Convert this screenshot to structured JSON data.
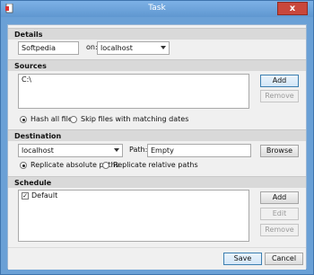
{
  "window": {
    "title": "Task",
    "close_glyph": "x"
  },
  "details": {
    "header": "Details",
    "name_value": "Softpedia",
    "on_label": "on:",
    "host_value": "localhost"
  },
  "sources": {
    "header": "Sources",
    "items": [
      "C:\\"
    ],
    "add_label": "Add",
    "remove_label": "Remove",
    "radio_hash": "Hash all files",
    "radio_skip": "Skip files with matching dates"
  },
  "destination": {
    "header": "Destination",
    "host_value": "localhost",
    "path_label": "Path:",
    "path_value": "Empty",
    "browse_label": "Browse",
    "radio_absolute": "Replicate absolute paths",
    "radio_relative": "Replicate relative paths"
  },
  "schedule": {
    "header": "Schedule",
    "items": [
      {
        "label": "Default",
        "checked": true
      }
    ],
    "add_label": "Add",
    "edit_label": "Edit",
    "remove_label": "Remove"
  },
  "footer": {
    "save_label": "Save",
    "cancel_label": "Cancel"
  }
}
